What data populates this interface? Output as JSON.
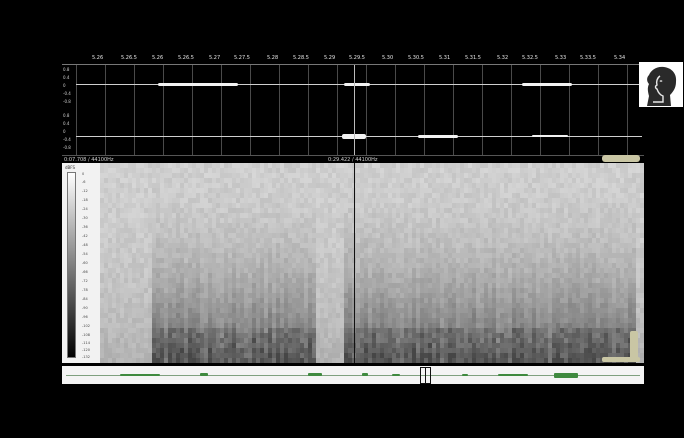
{
  "ruler": {
    "ticks": [
      "5.26",
      "5.26.5",
      "5.26",
      "5.26.5",
      "5.27",
      "5.27.5",
      "5.28",
      "5.28.5",
      "5.29",
      "5.29.5",
      "5.30",
      "5.30.5",
      "5.31",
      "5.31.5",
      "5.32",
      "5.32.5",
      "5.33",
      "5.33.5",
      "5.34"
    ]
  },
  "waveform": {
    "amplitude_labels": [
      "0.8",
      "0.4",
      "0",
      "-0.4",
      "-0.8",
      "0.8",
      "0.4",
      "0",
      "-0.4",
      "-0.8"
    ]
  },
  "status": {
    "left": "0:07.708 / 44100Hz",
    "middle": "0:29.422 / 44100Hz",
    "middle_sub": "0:29.422 / 44100Hz"
  },
  "spectrogram": {
    "scale_title": "dBFS",
    "scale_top": "0",
    "scale_labels": [
      "-6",
      "-12",
      "-18",
      "-24",
      "-30",
      "-36",
      "-42",
      "-48",
      "-54",
      "-60",
      "-66",
      "-72",
      "-78",
      "-84",
      "-90",
      "-96",
      "-102",
      "-108",
      "-114",
      "-120"
    ],
    "scale_bottom": "-132"
  },
  "colors": {
    "background": "#000000",
    "waveform_trace": "#f2f2f2",
    "overview_trace": "#3f8a3f",
    "scroll_knob": "#c9c6a4"
  },
  "icons": {
    "thumbnail": "face-profile-thumbnail-icon"
  }
}
